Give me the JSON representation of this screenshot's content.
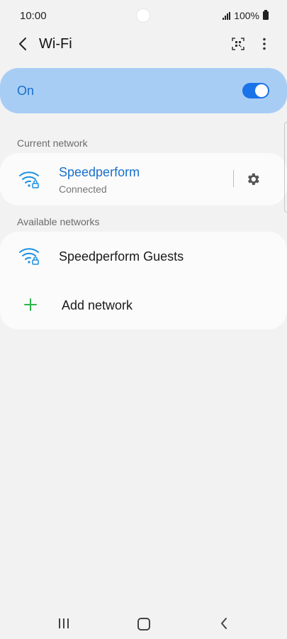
{
  "status_bar": {
    "time": "10:00",
    "battery": "100%"
  },
  "header": {
    "title": "Wi-Fi"
  },
  "wifi_toggle": {
    "label": "On",
    "state": "on",
    "accent": "#1a73e8"
  },
  "current_network": {
    "section_label": "Current network",
    "name": "Speedperform",
    "status": "Connected",
    "name_color": "#1a6fc9"
  },
  "available_networks": {
    "section_label": "Available networks",
    "items": [
      {
        "name": "Speedperform Guests",
        "icon": "wifi-lock-icon"
      }
    ],
    "add_network_label": "Add network"
  },
  "nav_bar": {
    "recents_icon": "recents-icon",
    "home_icon": "home-icon",
    "back_icon": "back-icon"
  }
}
